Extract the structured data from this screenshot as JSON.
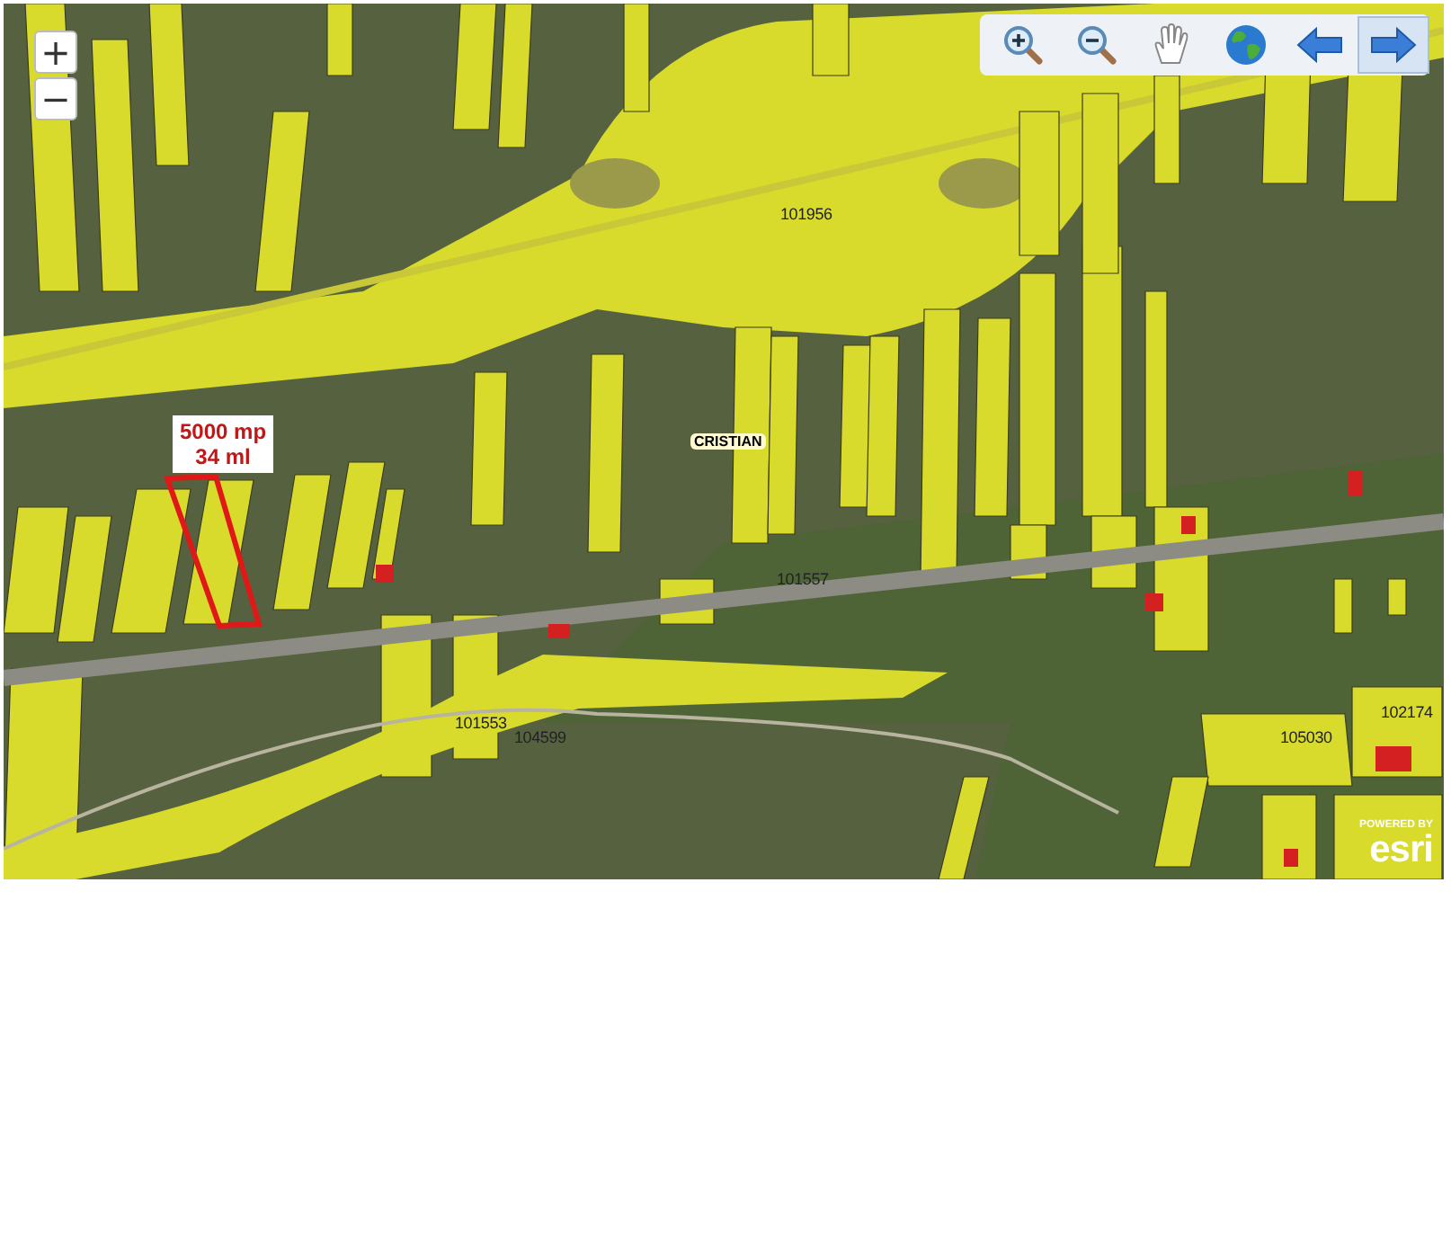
{
  "map": {
    "zoom_controls": [
      {
        "label": "+"
      },
      {
        "label": "−"
      }
    ],
    "toolbar": [
      {
        "kind": "zoom-in",
        "selected": false
      },
      {
        "kind": "zoom-out",
        "selected": false
      },
      {
        "kind": "pan",
        "selected": false
      },
      {
        "kind": "full-extent",
        "selected": false
      },
      {
        "kind": "previous",
        "selected": false
      },
      {
        "kind": "next",
        "selected": true
      }
    ],
    "labels": [
      {
        "kind": "parcel-number",
        "text": "101956"
      },
      {
        "kind": "annotation",
        "lines": [
          "5000 mp",
          "34 ml"
        ]
      },
      {
        "kind": "place-name",
        "text": "CRISTIAN"
      },
      {
        "kind": "parcel-number",
        "text": "101557"
      },
      {
        "kind": "parcel-number",
        "text": "102174"
      },
      {
        "kind": "parcel-number",
        "text": "101553"
      },
      {
        "kind": "parcel-number",
        "text": "104599"
      },
      {
        "kind": "parcel-number",
        "text": "105030"
      }
    ],
    "attribution": {
      "powered_by": "POWERED BY",
      "logo": "esri"
    }
  }
}
